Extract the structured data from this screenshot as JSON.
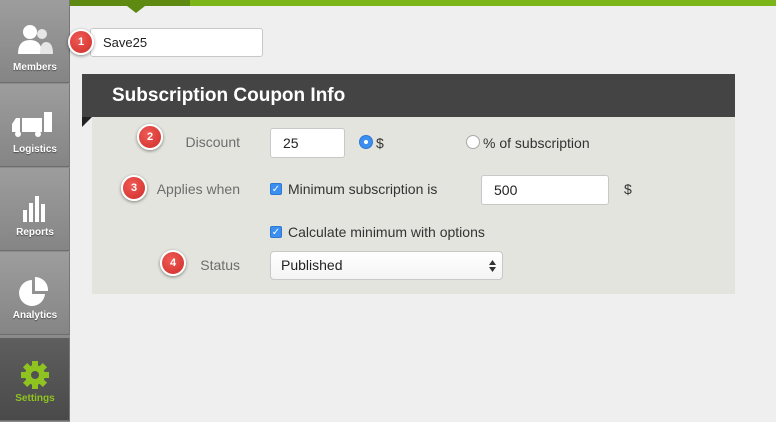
{
  "sidebar": {
    "items": [
      {
        "label": "Members",
        "icon": "members-icon"
      },
      {
        "label": "Logistics",
        "icon": "truck-icon"
      },
      {
        "label": "Reports",
        "icon": "bar-chart-icon"
      },
      {
        "label": "Analytics",
        "icon": "pie-chart-icon"
      },
      {
        "label": "Settings",
        "icon": "gear-icon",
        "active": true
      }
    ]
  },
  "coupon": {
    "code": "Save25"
  },
  "badges": [
    "1",
    "2",
    "3",
    "4"
  ],
  "panel": {
    "title": "Subscription Coupon Info",
    "discount_label": "Discount",
    "discount_value": "25",
    "dollar_option": "$",
    "percent_option": "% of subscription",
    "applies_label": "Applies when",
    "min_sub_label": "Minimum subscription is",
    "min_sub_value": "500",
    "min_sub_unit": "$",
    "calc_label": "Calculate minimum with options",
    "status_label": "Status",
    "status_value": "Published"
  },
  "colors": {
    "accent": "#7cb518",
    "header": "#444444",
    "badge": "#d9342f",
    "check": "#3b8ff0"
  }
}
